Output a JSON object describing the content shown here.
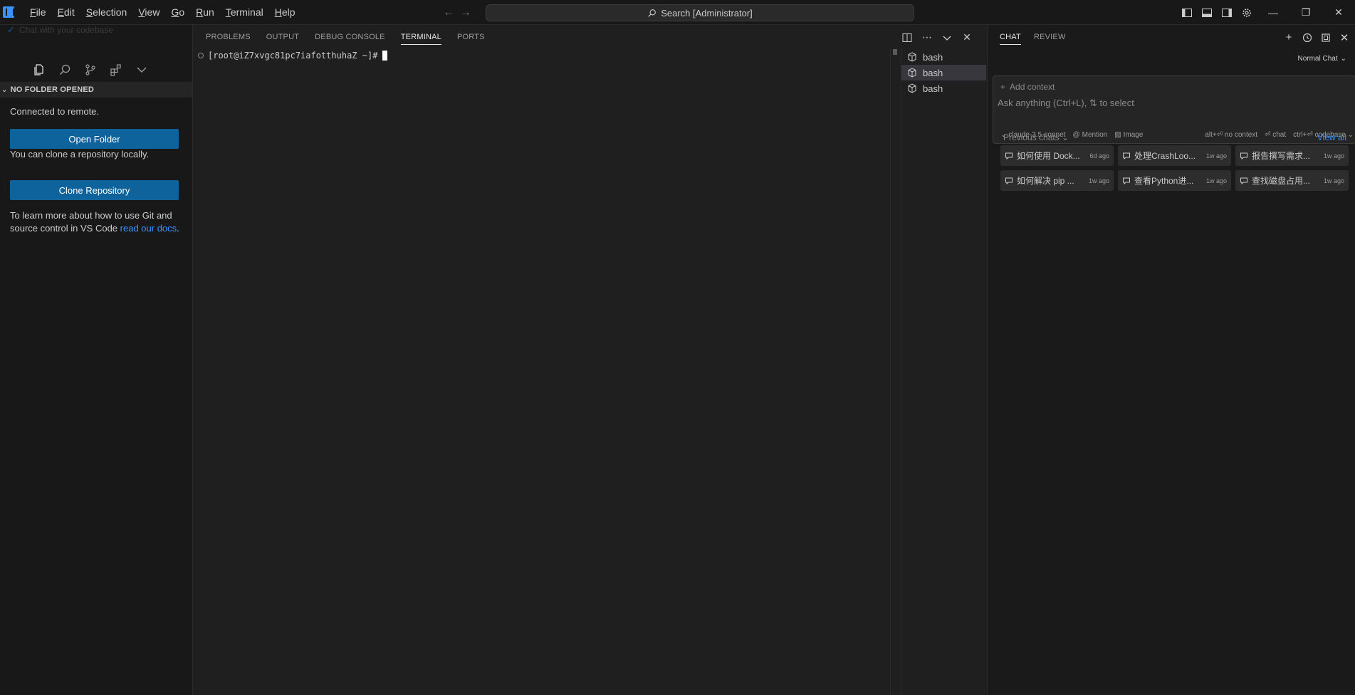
{
  "titlebar": {
    "menu": [
      "File",
      "Edit",
      "Selection",
      "View",
      "Go",
      "Run",
      "Terminal",
      "Help"
    ],
    "search_text": "Search [Administrator]",
    "icons": [
      "back-arrow-icon",
      "forward-arrow-icon",
      "search-icon",
      "toggle-primary-sidebar-icon",
      "toggle-panel-icon",
      "toggle-secondary-sidebar-icon",
      "gear-icon",
      "minimize-icon",
      "restore-icon",
      "close-icon"
    ]
  },
  "sidebar": {
    "ghost_text": "Chat with your codebase",
    "section_title": "NO FOLDER OPENED",
    "connected_text": "Connected to remote.",
    "open_folder_label": "Open Folder",
    "clone_text": "You can clone a repository locally.",
    "clone_label": "Clone Repository",
    "learn_text": "To learn more about how to use Git and source control in VS Code",
    "learn_link": "read our docs",
    "learn_end": "."
  },
  "panel": {
    "tabs": [
      "PROBLEMS",
      "OUTPUT",
      "DEBUG CONSOLE",
      "TERMINAL",
      "PORTS"
    ],
    "active_tab": "TERMINAL",
    "prompt": "[root@iZ7xvgc81pc7iafotthuhaZ ~]#",
    "terminals": [
      "bash",
      "bash",
      "bash"
    ],
    "selected_terminal_index": 1
  },
  "chat": {
    "tabs": [
      "CHAT",
      "REVIEW"
    ],
    "active_tab": "CHAT",
    "mode": "Normal Chat",
    "add_context": "Add context",
    "placeholder": "Ask anything (Ctrl+L), ⇅ to select",
    "model": "claude-3.5-sonnet",
    "mention": "Mention",
    "image": "Image",
    "no_context": "alt+⏎ no context",
    "chat_shortcut": "⏎ chat",
    "codebase": "ctrl+⏎ codebase",
    "previous_chats": "Previous chats",
    "view_all": "View all",
    "history": [
      {
        "title": "如何使用 Dock...",
        "ago": "6d ago"
      },
      {
        "title": "处理CrashLoo...",
        "ago": "1w ago"
      },
      {
        "title": "报告撰写需求...",
        "ago": "1w ago"
      },
      {
        "title": "如何解决 pip ...",
        "ago": "1w ago"
      },
      {
        "title": "查看Python进...",
        "ago": "1w ago"
      },
      {
        "title": "查找磁盘占用...",
        "ago": "1w ago"
      }
    ]
  },
  "colors": {
    "accent": "#3794ff",
    "button": "#0e639c",
    "background": "#1f1f1f",
    "sidebar": "#181818"
  }
}
